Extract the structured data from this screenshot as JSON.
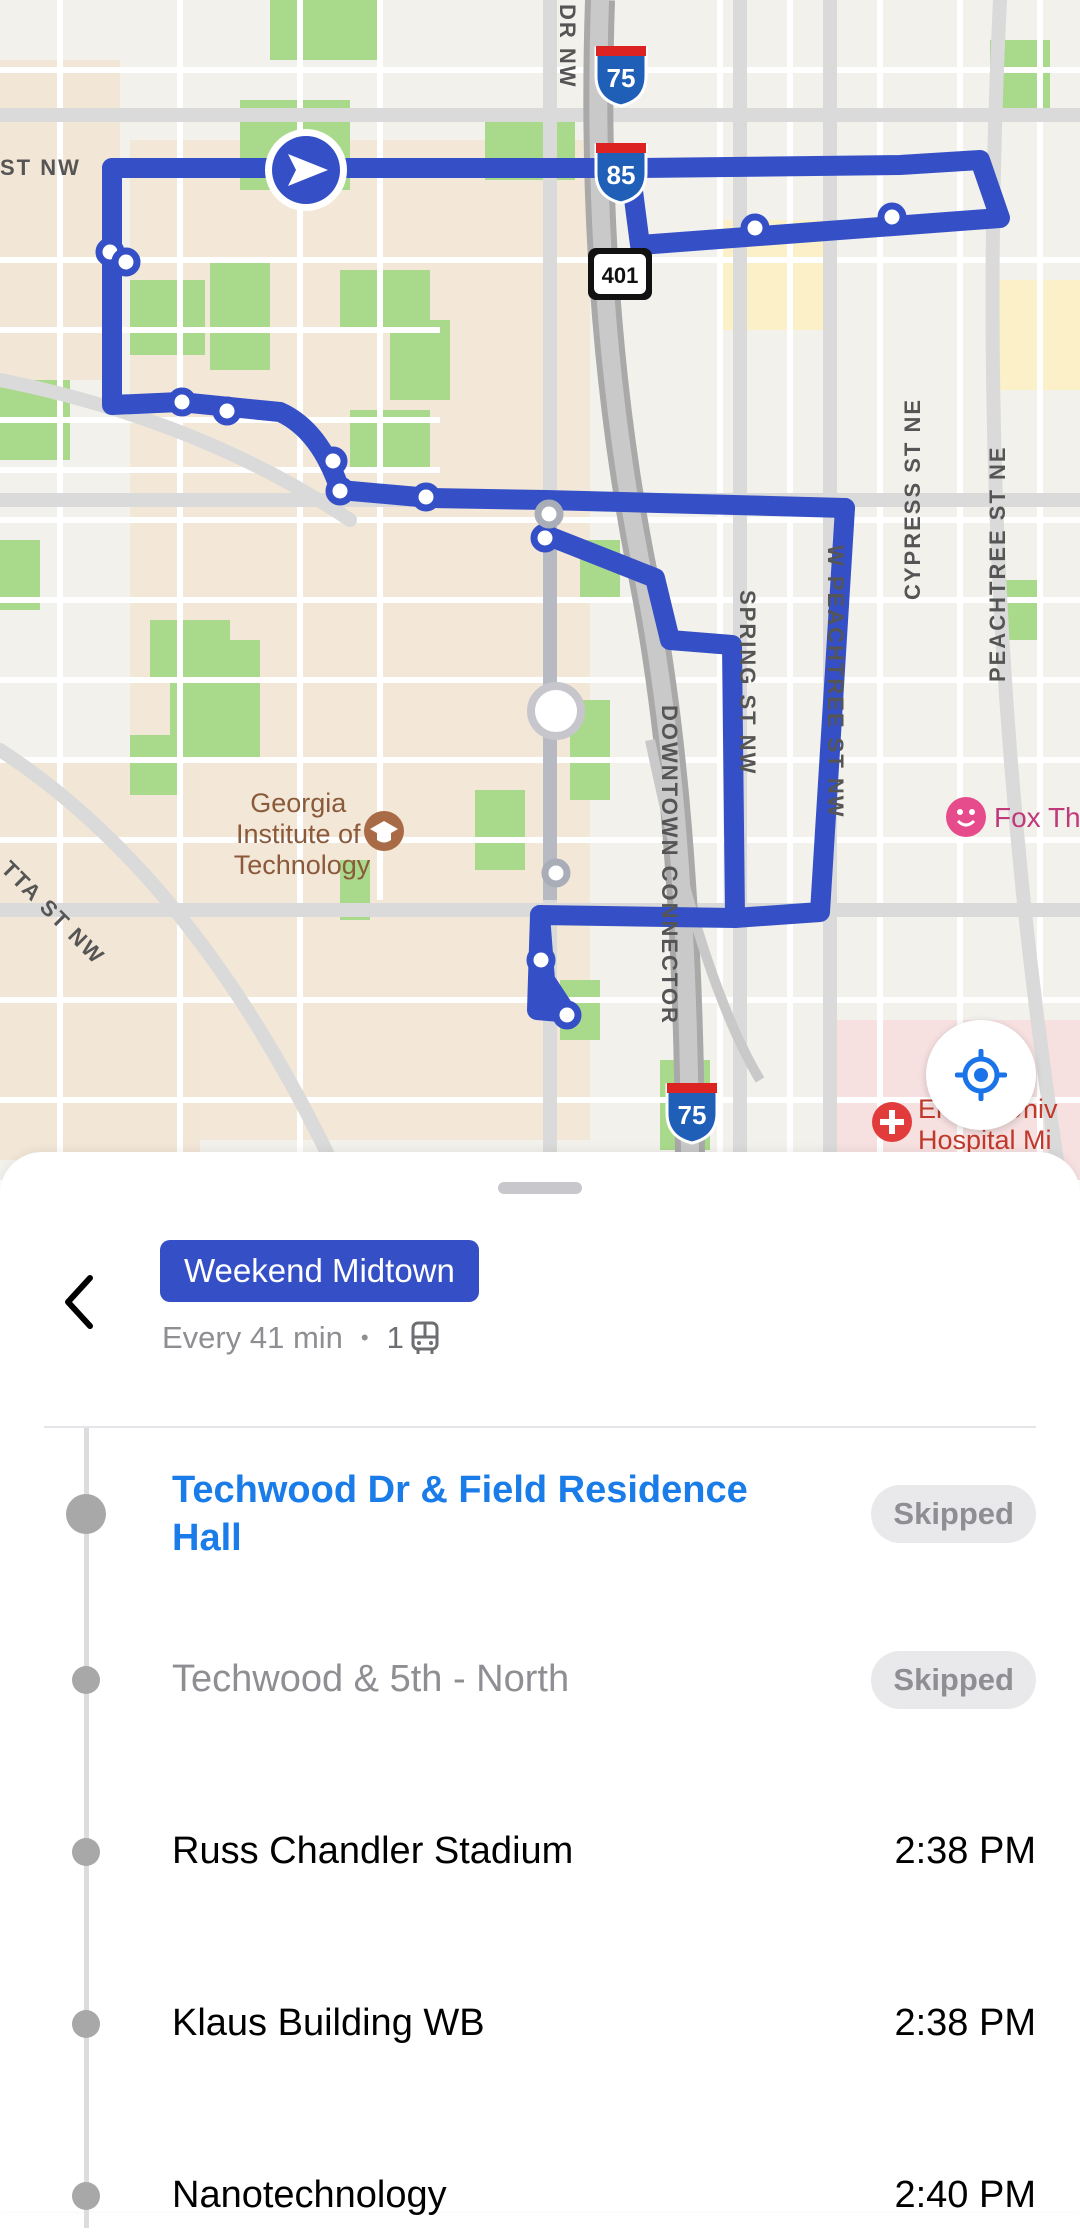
{
  "map": {
    "streets": [
      "ST NW",
      "TTA ST NW",
      "SPRING ST NW",
      "W PEACHTREE ST NW",
      "DOWNTOWN CONNECTOR",
      "CYPRESS ST NE",
      "PEACHTREE ST NE",
      "DR NW"
    ],
    "shields": {
      "i75_top": "75",
      "i85": "85",
      "us401": "401",
      "i75_bottom": "75"
    },
    "poi": {
      "georgia_tech": "Georgia\nInstitute of\nTechnology",
      "fox": "Fox Th",
      "hospital_line1": "Emory Univ",
      "hospital_line2": "Hospital Mi"
    },
    "route_color": "#3550c7",
    "icons": [
      "navigation-arrow-icon",
      "graduation-cap-icon",
      "theater-icon",
      "hospital-icon",
      "locate-icon"
    ]
  },
  "route": {
    "name": "Weekend Midtown",
    "frequency": "Every 41 min",
    "separator": "•",
    "vehicle_count": "1",
    "badge_color": "#3550c7"
  },
  "stops": [
    {
      "name": "Techwood Dr & Field Residence Hall",
      "name_line1": "Techwood Dr & Field Residence",
      "name_line2": "Hall",
      "status": "Skipped",
      "state": "current"
    },
    {
      "name": "Techwood & 5th  - North",
      "status": "Skipped",
      "state": "skipped"
    },
    {
      "name": "Russ Chandler Stadium",
      "time": "2:38 PM",
      "state": "upcoming"
    },
    {
      "name": "Klaus Building WB",
      "time": "2:38 PM",
      "state": "upcoming"
    },
    {
      "name": "Nanotechnology",
      "time": "2:40 PM",
      "state": "upcoming"
    }
  ]
}
